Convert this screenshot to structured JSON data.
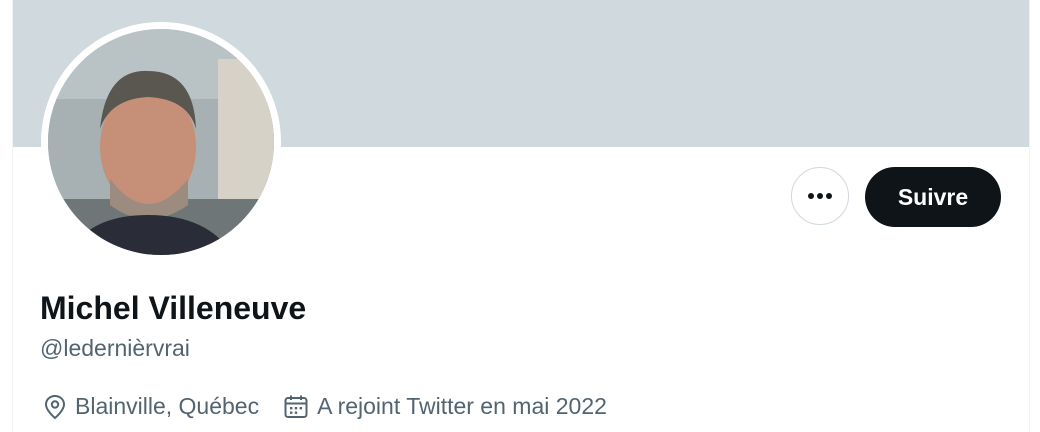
{
  "profile": {
    "name": "Michel Villeneuve",
    "handle": "@ledernièrvrai",
    "location": "Blainville, Québec",
    "joined": "A rejoint Twitter en mai 2022"
  },
  "actions": {
    "follow_label": "Suivre",
    "more_icon": "more-horizontal-icon"
  },
  "colors": {
    "banner": "#cfd9de",
    "follow_bg": "#0f1419",
    "secondary_text": "#536471"
  }
}
